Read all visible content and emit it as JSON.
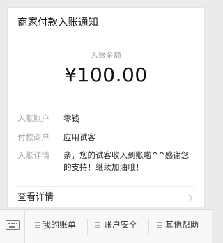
{
  "card": {
    "title": "商家付款入账通知",
    "amount_label": "入账金额",
    "amount": "¥100.00",
    "rows": [
      {
        "key": "入账账户",
        "value": "零钱"
      },
      {
        "key": "付款商户",
        "value": "应用试客"
      },
      {
        "key": "入账详情",
        "value": "亲，您的试客收入到账啦^^感谢您的支持！继续加油哦！"
      }
    ],
    "details_label": "查看详情"
  },
  "menu": {
    "items": [
      {
        "label": "我的账单"
      },
      {
        "label": "账户安全"
      },
      {
        "label": "其他帮助"
      }
    ]
  }
}
